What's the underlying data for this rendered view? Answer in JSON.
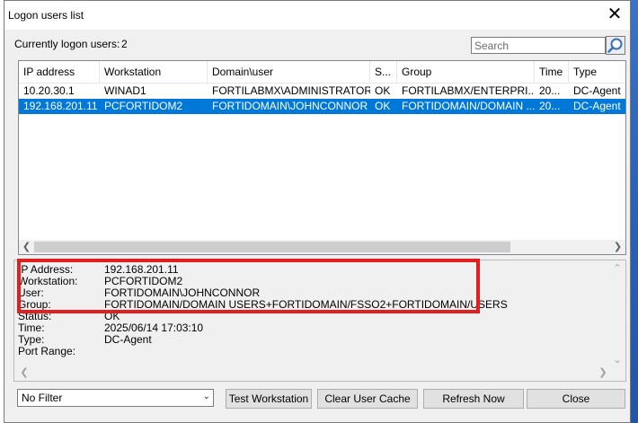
{
  "window": {
    "title": "Logon users list"
  },
  "summary": {
    "label": "Currently logon users:",
    "count": "2"
  },
  "search": {
    "placeholder": "Search"
  },
  "table": {
    "columns": [
      "IP address",
      "Workstation",
      "Domain\\user",
      "S...",
      "Group",
      "Time",
      "Type"
    ],
    "rows": [
      [
        "10.20.30.1",
        "WINAD1",
        "FORTILABMX\\ADMINISTRATOR",
        "OK",
        "FORTILABMX/ENTERPRI...",
        "20...",
        "DC-Agent"
      ],
      [
        "192.168.201.11",
        "PCFORTIDOM2",
        "FORTIDOMAIN\\JOHNCONNOR",
        "OK",
        "FORTIDOMAIN/DOMAIN ...",
        "20...",
        "DC-Agent"
      ]
    ],
    "selected_row": 1
  },
  "details": [
    {
      "label": "IP Address:",
      "value": "192.168.201.11"
    },
    {
      "label": "Workstation:",
      "value": "PCFORTIDOM2"
    },
    {
      "label": "User:",
      "value": "FORTIDOMAIN\\JOHNCONNOR"
    },
    {
      "label": "Group:",
      "value": "FORTIDOMAIN/DOMAIN USERS+FORTIDOMAIN/FSSO2+FORTIDOMAIN/USERS"
    },
    {
      "label": "Status:",
      "value": "OK"
    },
    {
      "label": "Time:",
      "value": "2025/06/14 17:03:10"
    },
    {
      "label": "Type:",
      "value": "DC-Agent"
    },
    {
      "label": "Port Range:",
      "value": ""
    }
  ],
  "filter": {
    "selected": "No Filter"
  },
  "buttons": {
    "test_workstation": "Test Workstation",
    "clear_user_cache": "Clear User Cache",
    "refresh_now": "Refresh Now",
    "close": "Close"
  },
  "colors": {
    "selection": "#0078d7",
    "highlight": "#e02020"
  }
}
